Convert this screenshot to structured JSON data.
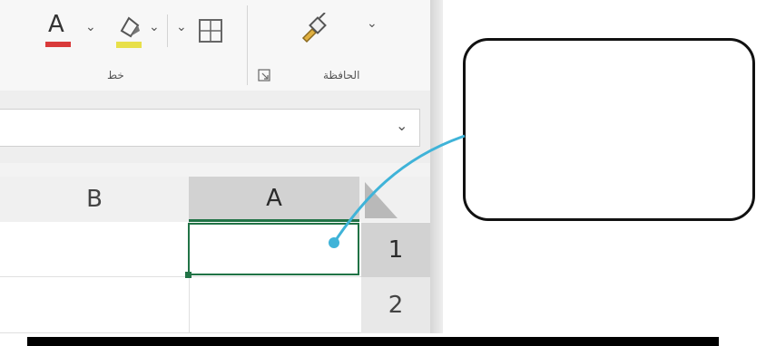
{
  "ribbon": {
    "font_group_label": "خط",
    "clipboard_group_label": "الحافظة",
    "font_color": "#d93a3a",
    "highlight_color": "#e8e04a",
    "icons": [
      "font-color-icon",
      "highlight-icon",
      "border-icon",
      "paint-icon",
      "dialog-launcher-icon",
      "chevron-down-icon"
    ]
  },
  "font_color_letter": "A",
  "sheet": {
    "columns": [
      "B",
      "A"
    ],
    "rows": [
      "1",
      "2"
    ],
    "active_cell": "A1",
    "accent_color": "#217346"
  },
  "callout": {
    "text": "",
    "line_color": "#3fb3d8"
  }
}
